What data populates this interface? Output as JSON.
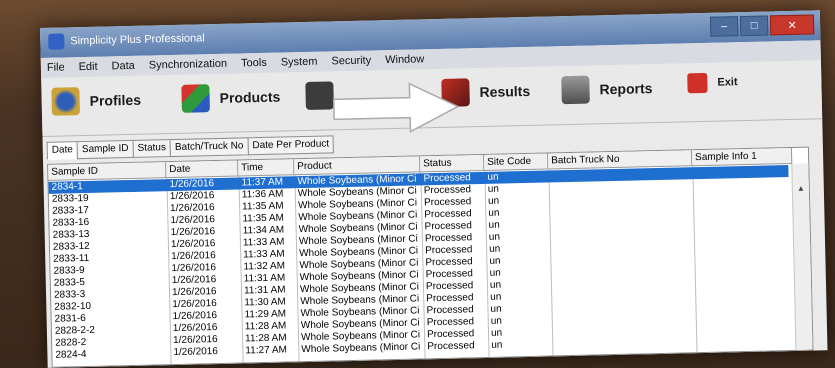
{
  "window": {
    "title": "Simplicity Plus Professional"
  },
  "menu": [
    "File",
    "Edit",
    "Data",
    "Synchronization",
    "Tools",
    "System",
    "Security",
    "Window"
  ],
  "toolbar": [
    {
      "label": "Profiles",
      "icon": "profiles-icon"
    },
    {
      "label": "Products",
      "icon": "products-icon"
    },
    {
      "label": "Results",
      "icon": "results-icon"
    },
    {
      "label": "Reports",
      "icon": "reports-icon"
    },
    {
      "label": "Exit",
      "icon": "exit-icon"
    }
  ],
  "tabs": [
    "Date",
    "Sample ID",
    "Status",
    "Batch/Truck No",
    "Date Per Product"
  ],
  "columns": [
    "Sample ID",
    "Date",
    "Time",
    "Product",
    "Status",
    "Site Code",
    "Batch Truck No",
    "Sample Info 1"
  ],
  "rows": [
    {
      "id": "2834-1",
      "date": "1/26/2016",
      "time": "11:37 AM",
      "product": "Whole Soybeans (Minor Ci",
      "status": "Processed",
      "site": "un",
      "selected": true
    },
    {
      "id": "2833-19",
      "date": "1/26/2016",
      "time": "11:36 AM",
      "product": "Whole Soybeans (Minor Ci",
      "status": "Processed",
      "site": "un"
    },
    {
      "id": "2833-17",
      "date": "1/26/2016",
      "time": "11:35 AM",
      "product": "Whole Soybeans (Minor Ci",
      "status": "Processed",
      "site": "un"
    },
    {
      "id": "2833-16",
      "date": "1/26/2016",
      "time": "11:35 AM",
      "product": "Whole Soybeans (Minor Ci",
      "status": "Processed",
      "site": "un"
    },
    {
      "id": "2833-13",
      "date": "1/26/2016",
      "time": "11:34 AM",
      "product": "Whole Soybeans (Minor Ci",
      "status": "Processed",
      "site": "un"
    },
    {
      "id": "2833-12",
      "date": "1/26/2016",
      "time": "11:33 AM",
      "product": "Whole Soybeans (Minor Ci",
      "status": "Processed",
      "site": "un"
    },
    {
      "id": "2833-11",
      "date": "1/26/2016",
      "time": "11:33 AM",
      "product": "Whole Soybeans (Minor Ci",
      "status": "Processed",
      "site": "un"
    },
    {
      "id": "2833-9",
      "date": "1/26/2016",
      "time": "11:32 AM",
      "product": "Whole Soybeans (Minor Ci",
      "status": "Processed",
      "site": "un"
    },
    {
      "id": "2833-5",
      "date": "1/26/2016",
      "time": "11:31 AM",
      "product": "Whole Soybeans (Minor Ci",
      "status": "Processed",
      "site": "un"
    },
    {
      "id": "2833-3",
      "date": "1/26/2016",
      "time": "11:31 AM",
      "product": "Whole Soybeans (Minor Ci",
      "status": "Processed",
      "site": "un"
    },
    {
      "id": "2832-10",
      "date": "1/26/2016",
      "time": "11:30 AM",
      "product": "Whole Soybeans (Minor Ci",
      "status": "Processed",
      "site": "un"
    },
    {
      "id": "2831-6",
      "date": "1/26/2016",
      "time": "11:29 AM",
      "product": "Whole Soybeans (Minor Ci",
      "status": "Processed",
      "site": "un"
    },
    {
      "id": "2828-2-2",
      "date": "1/26/2016",
      "time": "11:28 AM",
      "product": "Whole Soybeans (Minor Ci",
      "status": "Processed",
      "site": "un"
    },
    {
      "id": "2828-2",
      "date": "1/26/2016",
      "time": "11:28 AM",
      "product": "Whole Soybeans (Minor Ci",
      "status": "Processed",
      "site": "un"
    },
    {
      "id": "2824-4",
      "date": "1/26/2016",
      "time": "11:27 AM",
      "product": "Whole Soybeans (Minor Ci",
      "status": "Processed",
      "site": "un"
    }
  ]
}
